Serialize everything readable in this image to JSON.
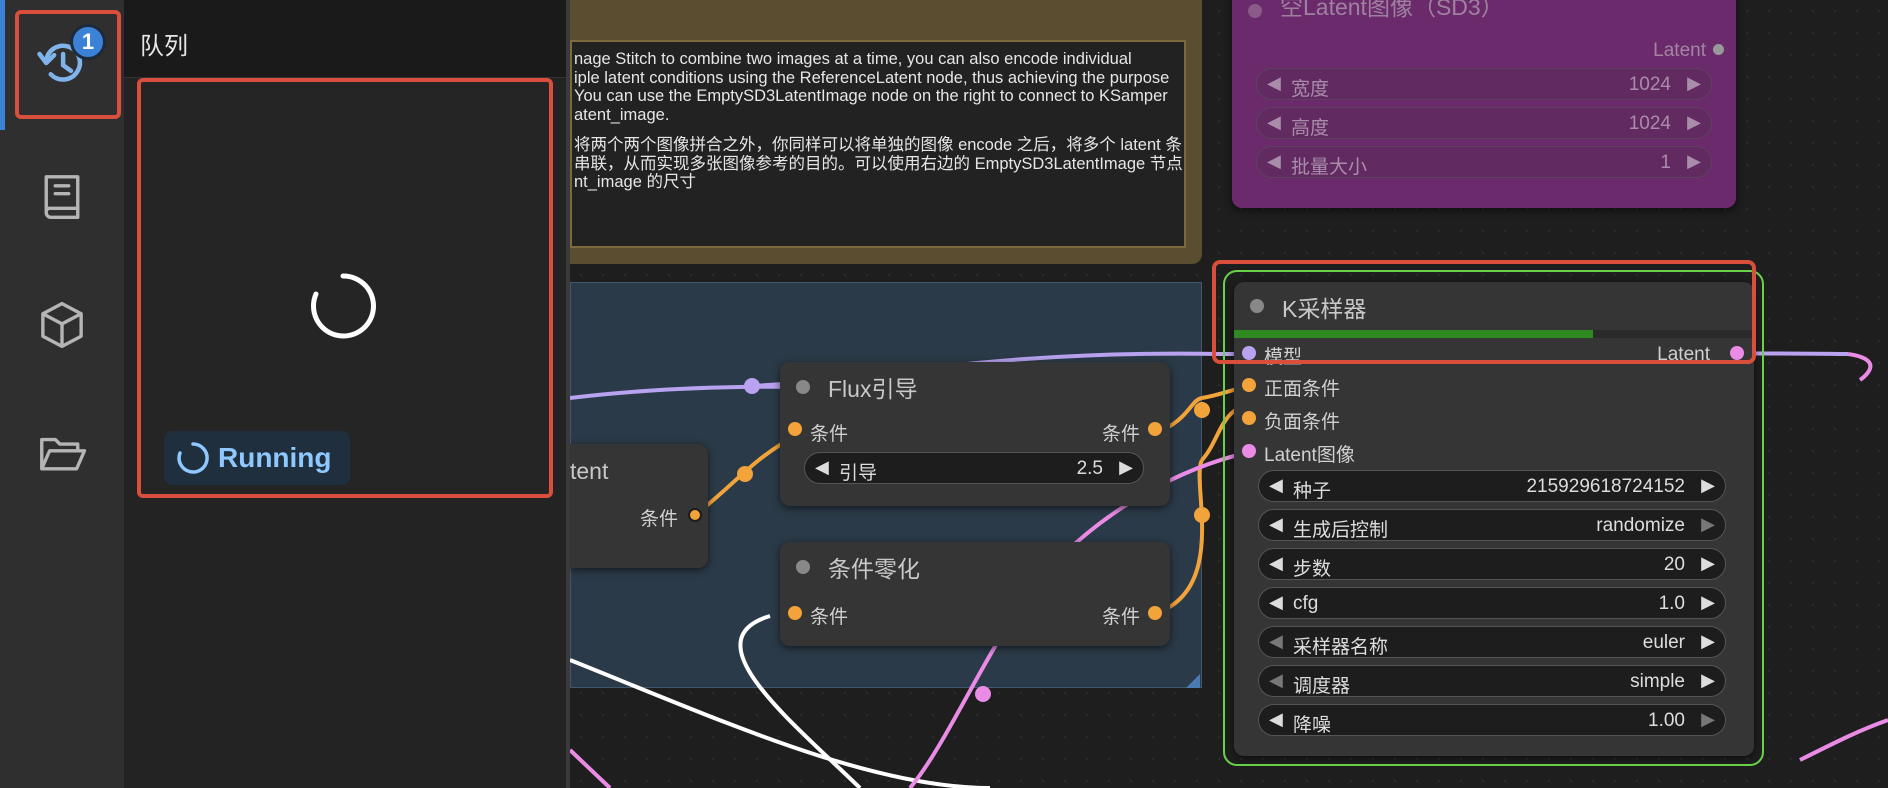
{
  "sidebar": {
    "queue_badge": "1",
    "items": [
      {
        "name": "queue-history",
        "icon": "history-icon"
      },
      {
        "name": "library",
        "icon": "book-icon"
      },
      {
        "name": "models",
        "icon": "cube-icon"
      },
      {
        "name": "workflows",
        "icon": "folder-open-icon"
      }
    ]
  },
  "queue_panel": {
    "title": "队列",
    "task": {
      "status": "Running"
    }
  },
  "canvas": {
    "note": {
      "en_lines": [
        "nage Stitch to combine two images at a time, you can also encode individual",
        "iple latent conditions using the ReferenceLatent node, thus achieving the purpose",
        "You can use the EmptySD3LatentImage node on the right to connect to KSamper",
        "atent_image."
      ],
      "zh_lines": [
        "将两个两个图像拼合之外，你同样可以将单独的图像 encode 之后，将多个 latent 条",
        "串联，从而实现多张图像参考的目的。可以使用右边的 EmptySD3LatentImage 节点",
        "nt_image 的尺寸"
      ]
    },
    "empty_latent": {
      "title": "空Latent图像（SD3）",
      "output": "Latent",
      "widgets": [
        {
          "label": "宽度",
          "value": "1024"
        },
        {
          "label": "高度",
          "value": "1024"
        },
        {
          "label": "批量大小",
          "value": "1"
        }
      ]
    },
    "partial_node": {
      "title": "tent",
      "output": "条件"
    },
    "flux_guidance": {
      "title": "Flux引导",
      "input": "条件",
      "output": "条件",
      "widget": {
        "label": "引导",
        "value": "2.5"
      }
    },
    "cond_zero": {
      "title": "条件零化",
      "input": "条件",
      "output": "条件"
    },
    "ksampler": {
      "title": "K采样器",
      "progress": 0.69,
      "inputs": [
        "模型",
        "正面条件",
        "负面条件",
        "Latent图像"
      ],
      "output": "Latent",
      "widgets": [
        {
          "label": "种子",
          "value": "215929618724152"
        },
        {
          "label": "生成后控制",
          "value": "randomize"
        },
        {
          "label": "步数",
          "value": "20"
        },
        {
          "label": "cfg",
          "value": "1.0"
        },
        {
          "label": "采样器名称",
          "value": "euler"
        },
        {
          "label": "调度器",
          "value": "simple"
        },
        {
          "label": "降噪",
          "value": "1.00"
        }
      ]
    },
    "colors": {
      "model_wire": "#b9a2f0",
      "cond_wire": "#f2a33a",
      "latent_wire": "#ea8be6",
      "running_outline": "#6ad24a",
      "highlight": "#d94f3b",
      "progress": "#2f8a1f"
    }
  }
}
